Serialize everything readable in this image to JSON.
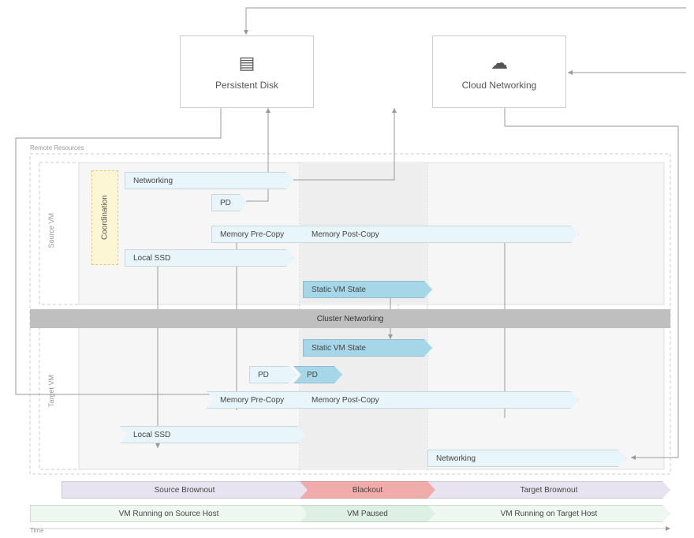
{
  "topBoxes": {
    "persistentDisk": "Persistent Disk",
    "cloudNetworking": "Cloud Networking"
  },
  "sectionLabel": "Remote Resources",
  "vmLabels": {
    "source": "Source VM",
    "target": "Target VM"
  },
  "coordination": "Coordination",
  "rows": {
    "networkingSrc": "Networking",
    "pd1": "PD",
    "memPre1": "Memory Pre-Copy",
    "memPost1": "Memory Post-Copy",
    "localSSD1": "Local SSD",
    "staticVM1": "Static VM State",
    "clusterNet": "Cluster Networking",
    "staticVM2": "Static VM State",
    "pd2a": "PD",
    "pd2b": "PD",
    "memPre2": "Memory Pre-Copy",
    "memPost2": "Memory Post-Copy",
    "localSSD2": "Local SSD",
    "networkingTgt": "Networking"
  },
  "phases": {
    "srcBrown": "Source Brownout",
    "blackout": "Blackout",
    "tgtBrown": "Target Brownout"
  },
  "states": {
    "srcRun": "VM Running on Source Host",
    "paused": "VM Paused",
    "tgtRun": "VM Running on Target Host"
  },
  "axis": "Time"
}
